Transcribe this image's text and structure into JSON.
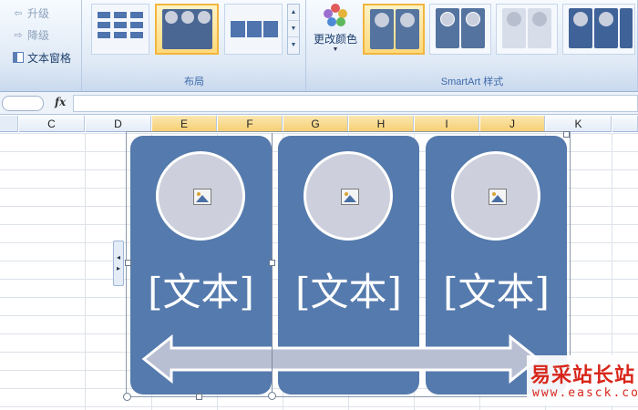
{
  "ribbon": {
    "create_graphic": {
      "promote": "升级",
      "demote": "降级",
      "text_pane": "文本窗格"
    },
    "layouts": {
      "label": "布局"
    },
    "smartart_styles": {
      "label": "SmartArt 样式",
      "change_colors": "更改颜色"
    }
  },
  "formula_bar": {
    "fx": "fx",
    "value": ""
  },
  "columns": [
    "C",
    "D",
    "E",
    "F",
    "G",
    "H",
    "I",
    "J",
    "K"
  ],
  "smartart": {
    "panels": [
      {
        "text": "[文本]"
      },
      {
        "text": "[文本]"
      },
      {
        "text": "[文本]"
      }
    ]
  },
  "watermark": {
    "title": "易采站长站",
    "url": "www.easck.com"
  },
  "colors": {
    "panel": "#557aad",
    "circle": "#cdd0dc",
    "arrow": "#b9bfd3",
    "ribbon_text": "#15428b"
  }
}
